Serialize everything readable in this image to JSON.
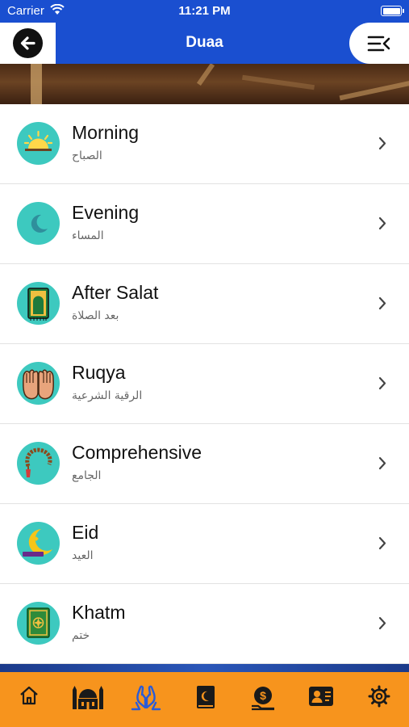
{
  "status_bar": {
    "carrier": "Carrier",
    "time": "11:21 PM"
  },
  "header": {
    "title": "Duaa"
  },
  "items": [
    {
      "title": "Morning",
      "subtitle": "الصباح",
      "icon": "sunrise-icon"
    },
    {
      "title": "Evening",
      "subtitle": "المساء",
      "icon": "crescent-moon-icon"
    },
    {
      "title": "After Salat",
      "subtitle": "بعد الصلاة",
      "icon": "prayer-mat-icon"
    },
    {
      "title": "Ruqya",
      "subtitle": "الرقية الشرعية",
      "icon": "praying-hands-icon"
    },
    {
      "title": "Comprehensive",
      "subtitle": "الجامع",
      "icon": "prayer-beads-icon"
    },
    {
      "title": "Eid",
      "subtitle": "العيد",
      "icon": "eid-moon-icon"
    },
    {
      "title": "Khatm",
      "subtitle": "ختم",
      "icon": "quran-icon"
    }
  ],
  "tabs": [
    {
      "name": "home-tab",
      "icon": "home-icon"
    },
    {
      "name": "mosque-tab",
      "icon": "mosque-icon"
    },
    {
      "name": "duaa-tab",
      "icon": "praying-hands-icon",
      "active": true
    },
    {
      "name": "quran-tab",
      "icon": "quran-book-icon"
    },
    {
      "name": "zakat-tab",
      "icon": "coin-hand-icon"
    },
    {
      "name": "contacts-tab",
      "icon": "contact-card-icon"
    },
    {
      "name": "settings-tab",
      "icon": "gear-icon"
    }
  ],
  "colors": {
    "header_blue": "#1a4fd0",
    "tab_orange": "#f7941d",
    "active_tab_blue": "#2a5bd7",
    "icon_teal": "#3dc9bf"
  }
}
